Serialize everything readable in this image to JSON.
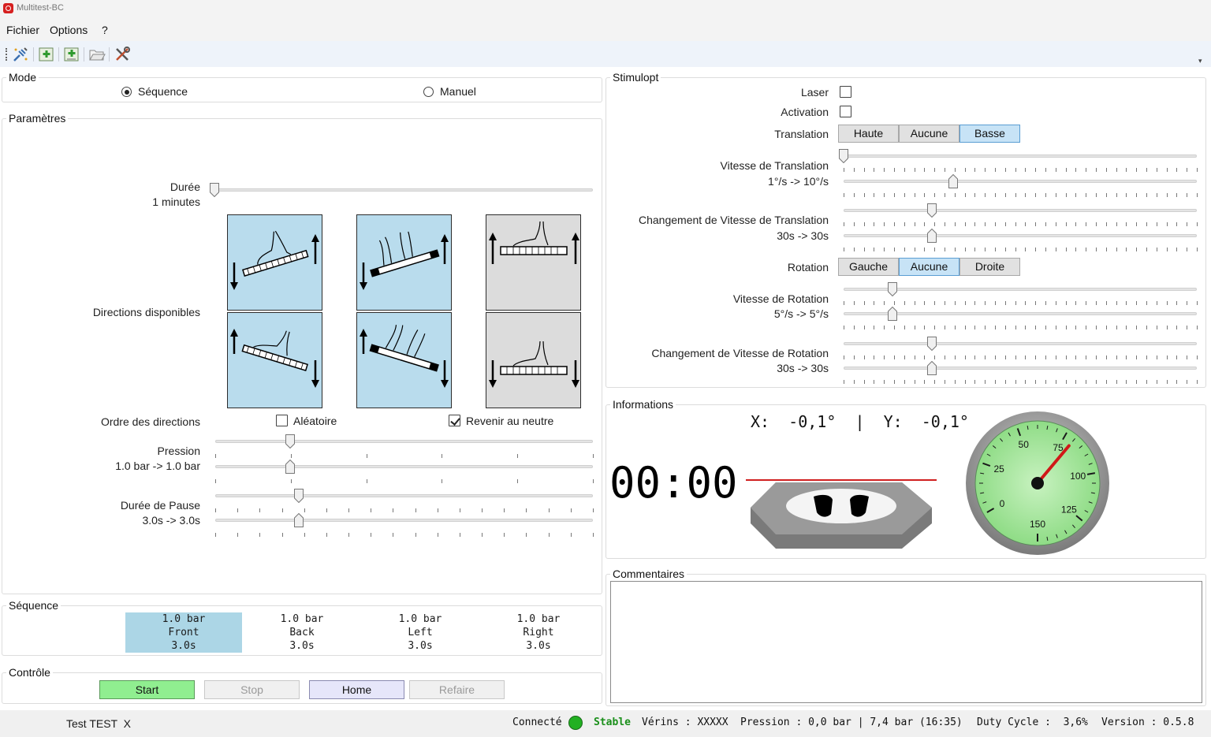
{
  "window": {
    "title": "Multitest-BC"
  },
  "menu": [
    "Fichier",
    "Options",
    "?"
  ],
  "toolbar": {
    "buttons": [
      "connect-icon",
      "add-patient-icon",
      "add-test-icon",
      "open-folder-icon",
      "settings-tools-icon"
    ]
  },
  "mode": {
    "title": "Mode",
    "options": [
      {
        "label": "Séquence",
        "selected": true
      },
      {
        "label": "Manuel",
        "selected": false
      }
    ]
  },
  "params": {
    "title": "Paramètres",
    "duration_label": "Durée",
    "duration_value": "1 minutes",
    "directions_label": "Directions disponibles",
    "tiles": [
      {
        "name": "front",
        "selected": true
      },
      {
        "name": "front-both",
        "selected": true
      },
      {
        "name": "up-neutral",
        "selected": false
      },
      {
        "name": "back",
        "selected": true
      },
      {
        "name": "back-both",
        "selected": true
      },
      {
        "name": "down-neutral",
        "selected": false
      }
    ],
    "order_label": "Ordre des directions",
    "random_label": "Aléatoire",
    "random_checked": false,
    "neutral_label": "Revenir au neutre",
    "neutral_checked": true,
    "pressure_label": "Pression",
    "pressure_value": "1.0 bar -> 1.0 bar",
    "pause_label": "Durée de Pause",
    "pause_value": "3.0s -> 3.0s"
  },
  "sequence": {
    "title": "Séquence",
    "items": [
      {
        "pressure": "1.0 bar",
        "direction": "Front",
        "time": "3.0s",
        "active": true
      },
      {
        "pressure": "1.0 bar",
        "direction": "Back",
        "time": "3.0s",
        "active": false
      },
      {
        "pressure": "1.0 bar",
        "direction": "Left",
        "time": "3.0s",
        "active": false
      },
      {
        "pressure": "1.0 bar",
        "direction": "Right",
        "time": "3.0s",
        "active": false
      }
    ]
  },
  "control": {
    "title": "Contrôle",
    "start": "Start",
    "stop": "Stop",
    "home": "Home",
    "redo": "Refaire",
    "colors": {
      "start": "#90ee90",
      "home": "#e6e6fa",
      "disabled": "#f0f0f0"
    }
  },
  "stimulopt": {
    "title": "Stimulopt",
    "laser_label": "Laser",
    "laser_checked": false,
    "activation_label": "Activation",
    "activation_checked": false,
    "translation_label": "Translation",
    "translation_options": [
      "Haute",
      "Aucune",
      "Basse"
    ],
    "translation_active": 2,
    "trans_speed_label": "Vitesse de Translation",
    "trans_speed_value": "1°/s -> 10°/s",
    "trans_change_label": "Changement de Vitesse de Translation",
    "trans_change_value": "30s -> 30s",
    "rotation_label": "Rotation",
    "rotation_options": [
      "Gauche",
      "Aucune",
      "Droite"
    ],
    "rotation_active": 1,
    "rot_speed_label": "Vitesse de Rotation",
    "rot_speed_value": "5°/s ->  5°/s",
    "rot_change_label": "Changement de Vitesse de Rotation",
    "rot_change_value": "30s -> 30s"
  },
  "info": {
    "title": "Informations",
    "xy": "X:  -0,1°  |  Y:  -0,1°",
    "timer": "00:00",
    "gauge": {
      "labels": [
        "0",
        "25",
        "50",
        "75",
        "100",
        "125",
        "150"
      ],
      "value": 80,
      "face_color": "#a8e6a0"
    }
  },
  "comments": {
    "title": "Commentaires",
    "text": ""
  },
  "status": {
    "user": "Test TEST  X",
    "connected": "Connecté",
    "stable": "Stable",
    "verins": "Vérins : XXXXX",
    "pression": "Pression : 0,0 bar | 7,4 bar (16:35)",
    "duty": "Duty Cycle :  3,6%",
    "version": "Version : 0.5.8",
    "led_color": "#22b022",
    "stable_color": "#1a8f1a"
  }
}
